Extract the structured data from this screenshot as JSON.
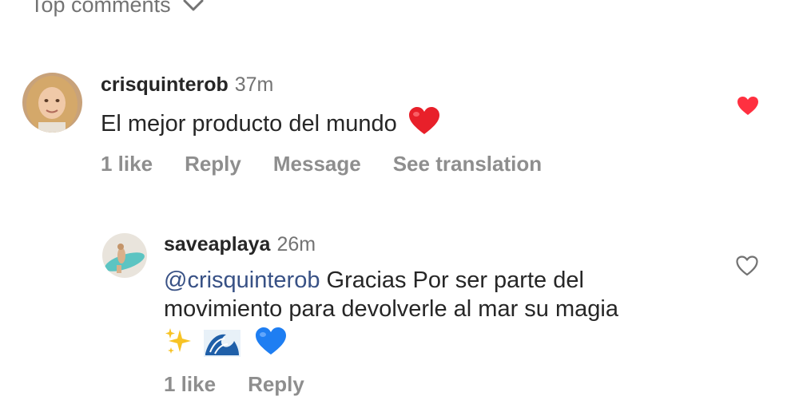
{
  "header": {
    "sort_label": "Top comments"
  },
  "comments": [
    {
      "username": "crisquinterob",
      "time": "37m",
      "text": "El mejor producto del mundo",
      "likes": "1 like",
      "reply": "Reply",
      "message": "Message",
      "translate": "See translation",
      "liked": true,
      "like_color": "#ff3040"
    },
    {
      "username": "saveaplaya",
      "time": "26m",
      "mention": "@crisquinterob",
      "text_line1": "Gracias Por ser parte del",
      "text_line2": "movimiento para devolverle al mar su magia",
      "likes": "1 like",
      "reply": "Reply",
      "liked": false,
      "mention_color": "#385185"
    }
  ],
  "icons": {
    "sort": "chevron-down-icon",
    "heart_filled": "heart-filled-icon",
    "heart_outline": "heart-outline-icon",
    "emoji_heart_red": "red-heart-emoji",
    "emoji_sparkles": "sparkles-emoji",
    "emoji_wave": "wave-emoji",
    "emoji_heart_blue": "blue-heart-emoji"
  }
}
